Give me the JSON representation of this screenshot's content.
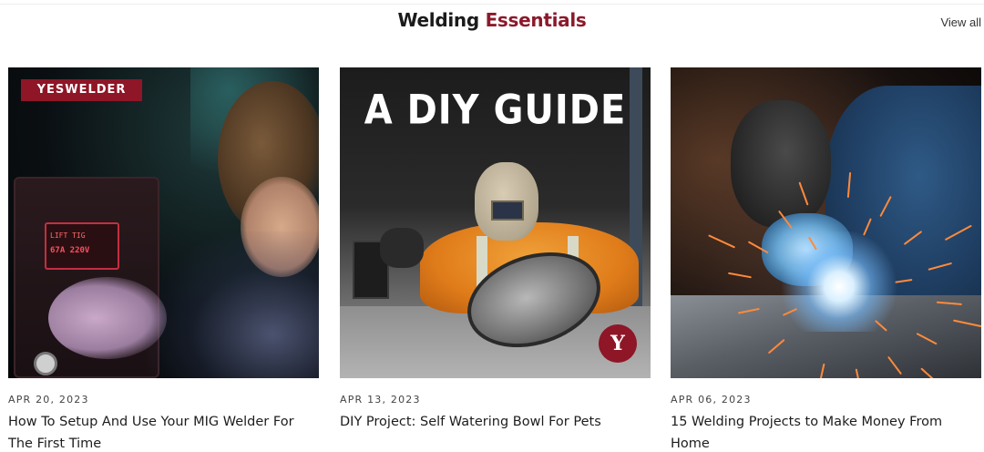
{
  "section": {
    "title_part1": "Welding",
    "title_part2": "Essentials",
    "view_all_label": "View all"
  },
  "cards": [
    {
      "date": "APR 20, 2023",
      "title": "How To Setup And Use Your MIG Welder For The First Time",
      "image": {
        "badge": "YESWELDER",
        "screen_line1": "LIFT TIG",
        "screen_line2": "67A   220V"
      }
    },
    {
      "date": "APR 13, 2023",
      "title": "DIY Project: Self Watering Bowl For Pets",
      "image": {
        "headline": "A DIY GUIDE",
        "logo": "Y"
      }
    },
    {
      "date": "APR 06, 2023",
      "title": "15 Welding Projects to Make Money From Home",
      "image": {}
    }
  ],
  "colors": {
    "accent": "#8b1a2b",
    "text": "#1d1d1d",
    "meta": "#444444"
  }
}
